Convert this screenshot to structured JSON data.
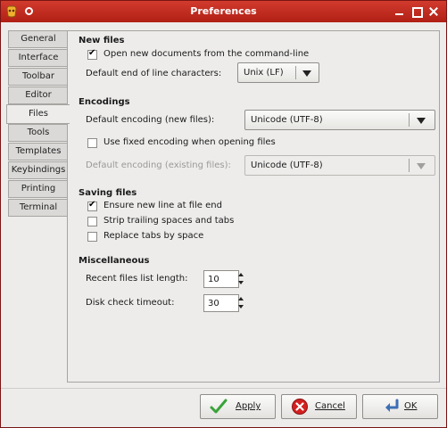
{
  "window": {
    "title": "Preferences"
  },
  "tabs": [
    "General",
    "Interface",
    "Toolbar",
    "Editor",
    "Files",
    "Tools",
    "Templates",
    "Keybindings",
    "Printing",
    "Terminal"
  ],
  "active_tab": "Files",
  "new_files": {
    "title": "New files",
    "open_new_docs_label": "Open new documents from the command-line",
    "open_new_docs_checked": true,
    "eol_label": "Default end of line characters:",
    "eol_value": "Unix (LF)"
  },
  "encodings": {
    "title": "Encodings",
    "default_new_label": "Default encoding (new files):",
    "default_new_value": "Unicode (UTF-8)",
    "use_fixed_label": "Use fixed encoding when opening files",
    "use_fixed_checked": false,
    "default_existing_label": "Default encoding (existing files):",
    "default_existing_value": "Unicode (UTF-8)"
  },
  "saving_files": {
    "title": "Saving files",
    "ensure_newline_label": "Ensure new line at file end",
    "ensure_newline_checked": true,
    "strip_trailing_label": "Strip trailing spaces and tabs",
    "strip_trailing_checked": false,
    "replace_tabs_label": "Replace tabs by space",
    "replace_tabs_checked": false
  },
  "misc": {
    "title": "Miscellaneous",
    "recent_files_label": "Recent files list length:",
    "recent_files_value": "10",
    "disk_check_label": "Disk check timeout:",
    "disk_check_value": "30"
  },
  "buttons": {
    "apply": "Apply",
    "cancel": "Cancel",
    "ok": "OK"
  },
  "colors": {
    "titlebar": "#c22c20",
    "apply_icon": "#3aa33a",
    "cancel_icon": "#d42020",
    "ok_icon": "#3d6fb5"
  }
}
